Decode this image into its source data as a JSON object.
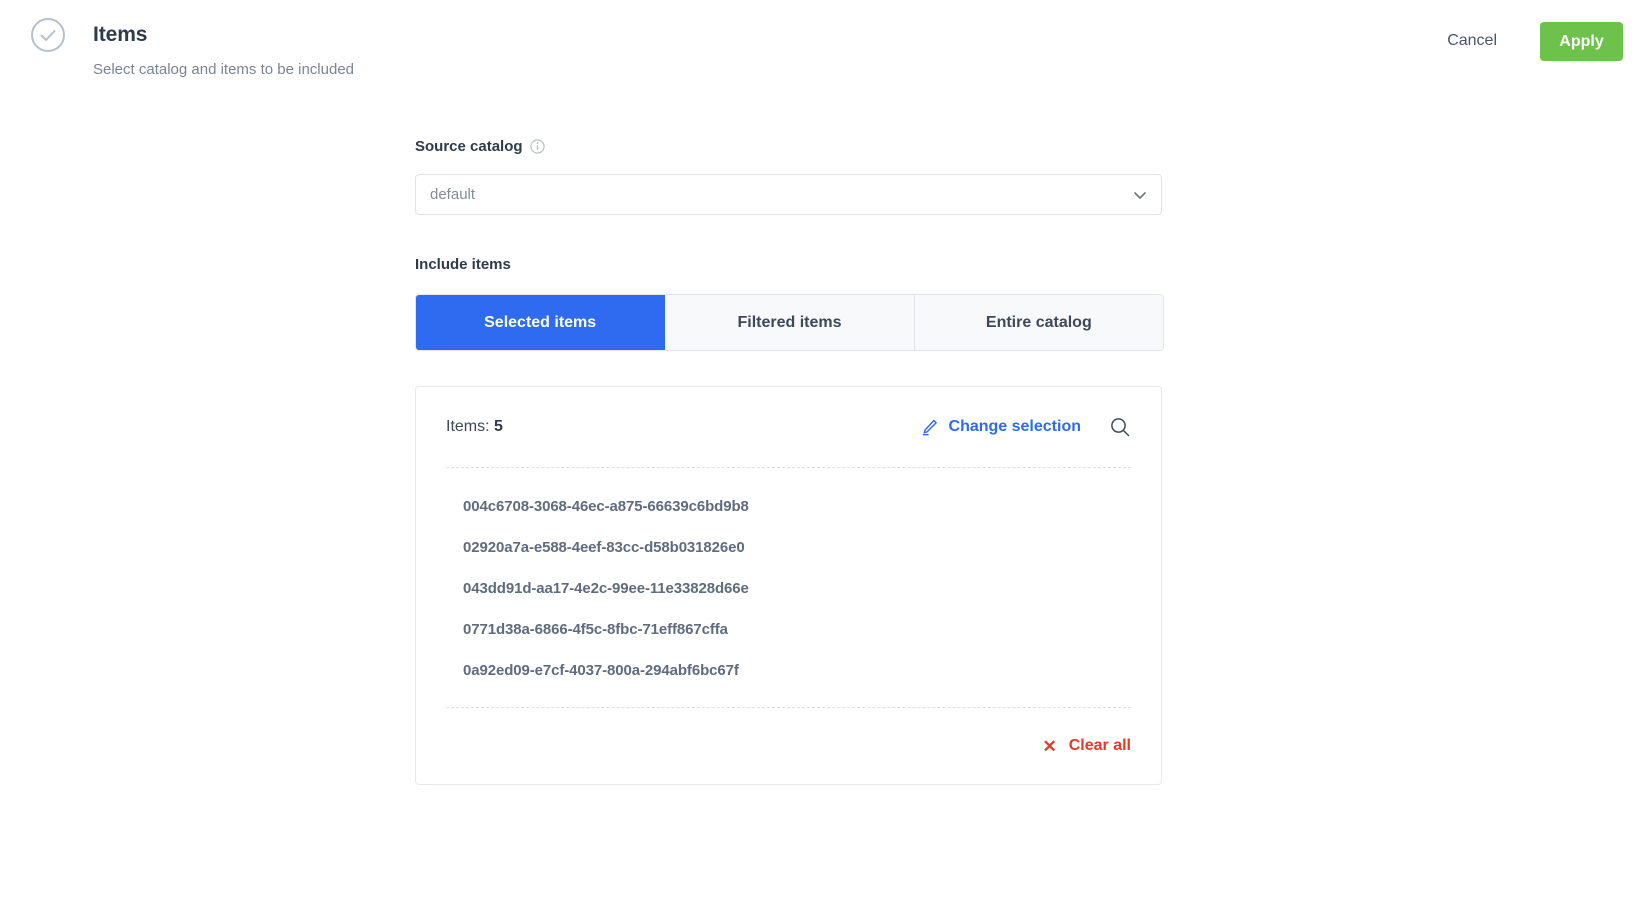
{
  "header": {
    "status_icon": "check-circle-icon",
    "title": "Items",
    "subtitle": "Select catalog and items to be included",
    "cancel_label": "Cancel",
    "apply_label": "Apply",
    "apply_color": "#6cc24a"
  },
  "source_catalog": {
    "label": "Source catalog",
    "info_icon": "info-icon",
    "value": "default",
    "chevron_icon": "chevron-down-icon"
  },
  "include_items": {
    "label": "Include items",
    "tabs": [
      {
        "label": "Selected items",
        "active": true
      },
      {
        "label": "Filtered items",
        "active": false
      },
      {
        "label": "Entire catalog",
        "active": false
      }
    ],
    "active_tab_color": "#2f6bf0"
  },
  "items_card": {
    "count_label": "Items:",
    "count_value": "5",
    "change_selection_label": "Change selection",
    "change_selection_icon": "pencil-icon",
    "search_icon": "search-icon",
    "link_color": "#2f6bf0",
    "items": [
      "004c6708-3068-46ec-a875-66639c6bd9b8",
      "02920a7a-e588-4eef-83cc-d58b031826e0",
      "043dd91d-aa17-4e2c-99ee-11e33828d66e",
      "0771d38a-6866-4f5c-8fbc-71eff867cffa",
      "0a92ed09-e7cf-4037-800a-294abf6bc67f"
    ],
    "clear_all_label": "Clear all",
    "clear_all_icon": "close-x-icon",
    "clear_all_color": "#e03c26"
  }
}
